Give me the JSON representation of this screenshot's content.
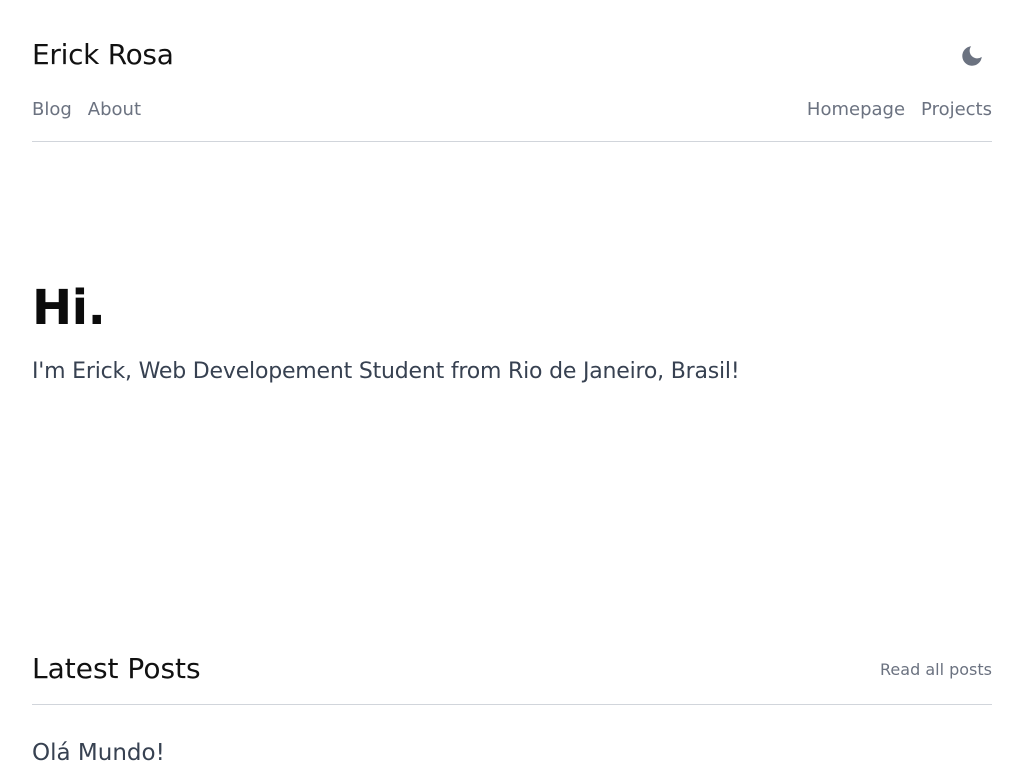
{
  "header": {
    "site_title": "Erick Rosa",
    "theme_toggle_icon": "moon-icon",
    "icon_color": "#6b7280"
  },
  "nav": {
    "left": [
      {
        "label": "Blog"
      },
      {
        "label": "About"
      }
    ],
    "right": [
      {
        "label": "Homepage"
      },
      {
        "label": "Projects"
      }
    ]
  },
  "hero": {
    "heading": "Hi.",
    "subtitle": "I'm Erick, Web Developement Student from Rio de Janeiro, Brasil!"
  },
  "posts": {
    "heading": "Latest Posts",
    "read_all_label": "Read all posts",
    "items": [
      {
        "title": "Olá Mundo!"
      }
    ]
  }
}
